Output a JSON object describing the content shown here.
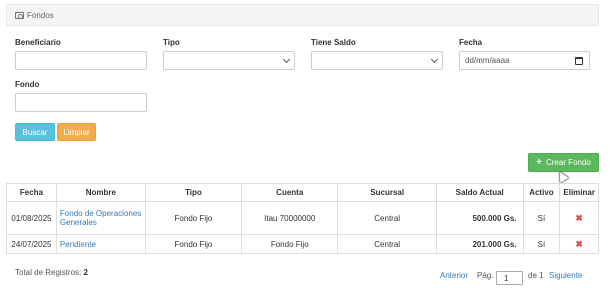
{
  "header": {
    "title": "Fondos",
    "icon": "money-icon"
  },
  "filters": {
    "beneficiario_label": "Beneficiario",
    "tipo_label": "Tipo",
    "tiene_saldo_label": "Tiene Saldo",
    "fecha_label": "Fecha",
    "fecha_placeholder": "dd/mm/aaaa",
    "fondo_label": "Fondo"
  },
  "buttons": {
    "buscar": "Buscar",
    "limpiar": "Limpiar",
    "crear_fondo": "Crear Fondo"
  },
  "table": {
    "headers": [
      "Fecha",
      "Nombre",
      "Tipo",
      "Cuenta",
      "Sucursal",
      "Saldo Actual",
      "Activo",
      "Eliminar"
    ],
    "rows": [
      {
        "fecha": "01/08/2025",
        "nombre": "Fondo de Operaciones Generales",
        "tipo": "Fondo Fijo",
        "cuenta": "Itau 70000000",
        "sucursal": "Central",
        "saldo": "500.000 Gs.",
        "activo": "Sí",
        "eliminar": "✖"
      },
      {
        "fecha": "24/07/2025",
        "nombre": "Pendiente",
        "tipo": "Fondo Fijo",
        "cuenta": "Fondo Fijo",
        "sucursal": "Central",
        "saldo": "201.000 Gs.",
        "activo": "Sí",
        "eliminar": "✖"
      }
    ]
  },
  "footer": {
    "total_label": "Total de Registros:",
    "total_count": "2",
    "anterior": "Anterior",
    "pag_label": "Pág.",
    "page_value": "1",
    "of_label": "de 1",
    "siguiente": "Siguiente"
  },
  "colors": {
    "buscar": "#5bc0de",
    "limpiar": "#f0ad4e",
    "crear": "#5cb85c",
    "link": "#337ab7",
    "delete": "#d9534f"
  }
}
